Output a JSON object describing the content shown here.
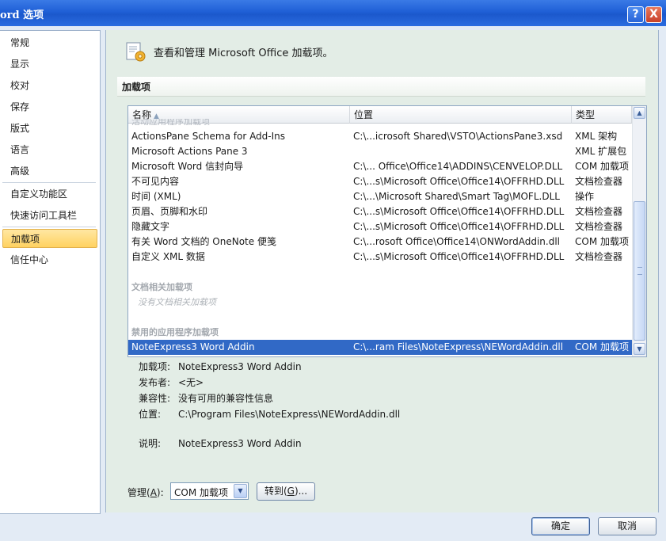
{
  "window": {
    "title": "ord 选项",
    "help_icon": "?",
    "close_icon": "X"
  },
  "sidebar": {
    "items": [
      {
        "label": "常规"
      },
      {
        "label": "显示"
      },
      {
        "label": "校对"
      },
      {
        "label": "保存"
      },
      {
        "label": "版式"
      },
      {
        "label": "语言"
      },
      {
        "label": "高级"
      },
      {
        "label": "自定义功能区"
      },
      {
        "label": "快速访问工具栏"
      },
      {
        "label": "加载项",
        "selected": true
      },
      {
        "label": "信任中心"
      }
    ]
  },
  "main": {
    "header_text": "查看和管理 Microsoft Office 加载项。",
    "section_title": "加载项",
    "columns": {
      "name": "名称",
      "location": "位置",
      "type": "类型"
    },
    "clipped_group": "活动应用程序加载项",
    "rows": [
      {
        "name": "ActionsPane Schema for Add-Ins",
        "location": "C:\\...icrosoft Shared\\VSTO\\ActionsPane3.xsd",
        "type": "XML 架构"
      },
      {
        "name": "Microsoft Actions Pane 3",
        "location": "",
        "type": "XML 扩展包"
      },
      {
        "name": "Microsoft Word 信封向导",
        "location": "C:\\... Office\\Office14\\ADDINS\\CENVELOP.DLL",
        "type": "COM 加载项"
      },
      {
        "name": "不可见内容",
        "location": "C:\\...s\\Microsoft Office\\Office14\\OFFRHD.DLL",
        "type": "文档检查器"
      },
      {
        "name": "时间 (XML)",
        "location": "C:\\...\\Microsoft Shared\\Smart Tag\\MOFL.DLL",
        "type": "操作"
      },
      {
        "name": "页眉、页脚和水印",
        "location": "C:\\...s\\Microsoft Office\\Office14\\OFFRHD.DLL",
        "type": "文档检查器"
      },
      {
        "name": "隐藏文字",
        "location": "C:\\...s\\Microsoft Office\\Office14\\OFFRHD.DLL",
        "type": "文档检查器"
      },
      {
        "name": "有关 Word 文档的 OneNote 便笺",
        "location": "C:\\...rosoft Office\\Office14\\ONWordAddin.dll",
        "type": "COM 加载项"
      },
      {
        "name": "自定义 XML 数据",
        "location": "C:\\...s\\Microsoft Office\\Office14\\OFFRHD.DLL",
        "type": "文档检查器"
      }
    ],
    "group_doc": "文档相关加载项",
    "group_doc_empty": "没有文档相关加载项",
    "group_disabled": "禁用的应用程序加载项",
    "selected_row": {
      "name": "NoteExpress3 Word Addin",
      "location": "C:\\...ram Files\\NoteExpress\\NEWordAddin.dll",
      "type": "COM 加载项"
    },
    "details": {
      "addin_label": "加载项:",
      "addin_value": "NoteExpress3 Word Addin",
      "publisher_label": "发布者:",
      "publisher_value": "<无>",
      "compat_label": "兼容性:",
      "compat_value": "没有可用的兼容性信息",
      "location_label": "位置:",
      "location_value": "C:\\Program Files\\NoteExpress\\NEWordAddin.dll",
      "desc_label": "说明:",
      "desc_value": "NoteExpress3 Word Addin"
    },
    "manage": {
      "label_prefix": "管理(",
      "label_key": "A",
      "label_suffix": "):",
      "selected": "COM 加载项",
      "goto_prefix": "转到(",
      "goto_key": "G",
      "goto_suffix": ")..."
    }
  },
  "footer": {
    "ok_label": "确定",
    "cancel_label": "取消"
  }
}
